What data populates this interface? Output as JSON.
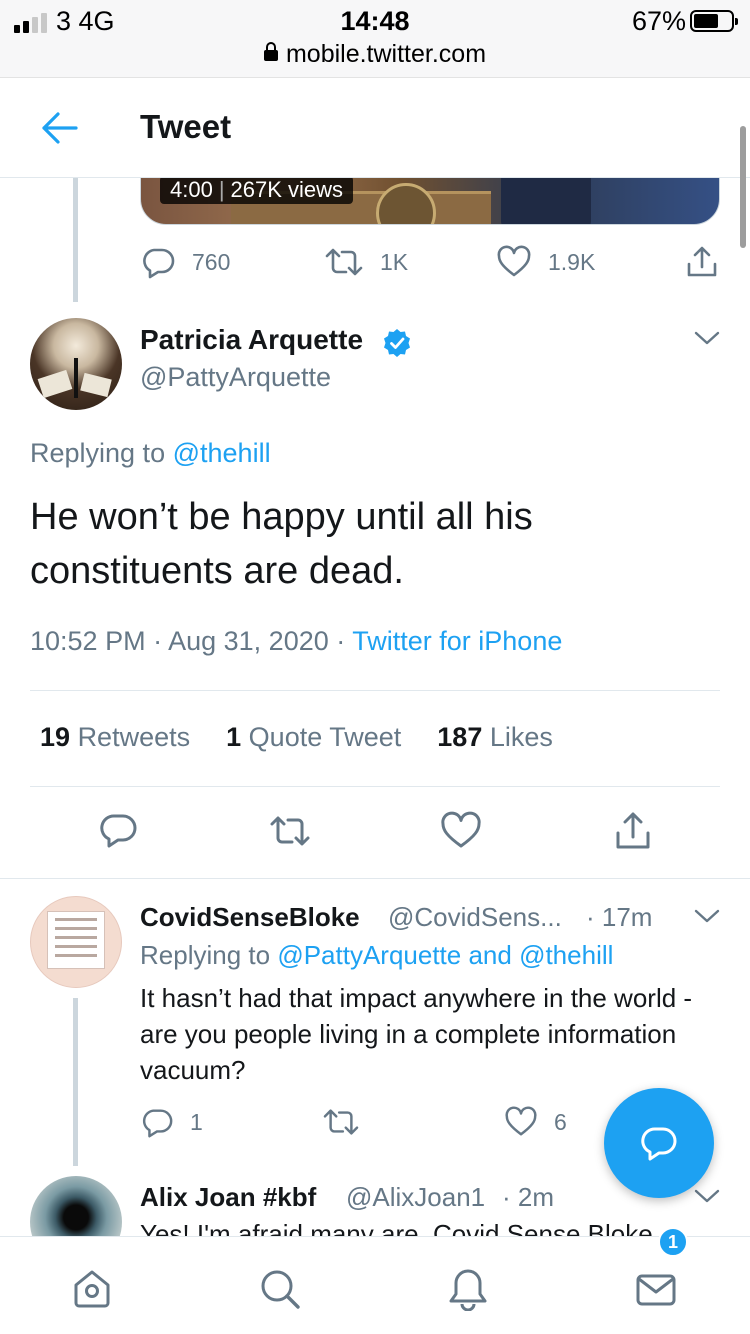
{
  "status_bar": {
    "carrier": "3  4G",
    "time": "14:48",
    "url": "mobile.twitter.com",
    "battery": "67%",
    "battery_level": 0.67
  },
  "header": {
    "title": "Tweet",
    "back_icon": "back-arrow-icon"
  },
  "previous_tweet": {
    "video_duration": "4:00",
    "video_views": "267K views",
    "replies": "760",
    "retweets": "1K",
    "likes": "1.9K"
  },
  "main_tweet": {
    "author_name": "Patricia Arquette",
    "author_handle": "@PattyArquette",
    "replying_prefix": "Replying to",
    "replying_to": "@thehill",
    "text": "He won’t be happy until all his constituents are dead.",
    "time": "10:52 PM",
    "date": "Aug 31, 2020",
    "source": "Twitter for iPhone",
    "retweet_count": "19",
    "retweet_label": "Retweets",
    "quote_count": "1",
    "quote_label": "Quote Tweet",
    "like_count": "187",
    "like_label": "Likes"
  },
  "replies": [
    {
      "author_name": "CovidSenseBloke",
      "author_handle": "@CovidSens...",
      "time": "· 17m",
      "replying_prefix": "Replying to",
      "replying_to": "@PattyArquette and @thehill",
      "text": "It hasn’t had that impact anywhere in the world - are you people living in a complete information vacuum?",
      "reply_count": "1",
      "like_count": "6"
    },
    {
      "author_name": "Alix Joan #kbf",
      "author_handle": "@AlixJoan1",
      "time": "· 2m",
      "text_preview": "Yes! I'm afraid many are. Covid Sense Bloke"
    }
  ],
  "bottom_nav": {
    "items": [
      "home-icon",
      "search-icon",
      "notifications-icon",
      "messages-icon"
    ],
    "messages_badge": "1"
  },
  "colors": {
    "accent": "#1da1f2",
    "text": "#14171a",
    "secondary": "#657786",
    "divider": "#e1e8ed"
  }
}
